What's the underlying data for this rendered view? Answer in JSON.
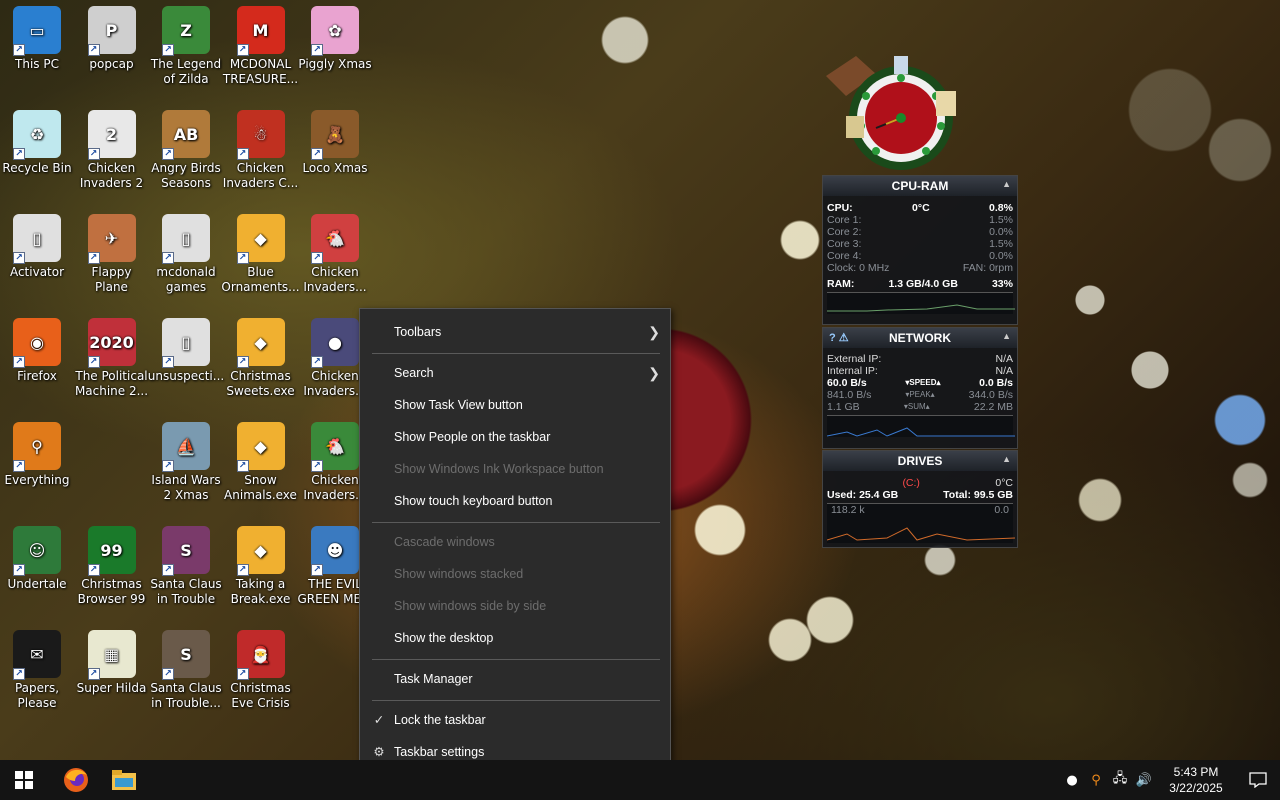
{
  "desktop": {
    "icons": [
      {
        "label": "This PC",
        "color": "#2a7fd0",
        "glyph": "▭"
      },
      {
        "label": "popcap",
        "color": "#cfcfcf",
        "glyph": "P"
      },
      {
        "label": "The Legend of Zilda",
        "color": "#3a8a3a",
        "glyph": "Z"
      },
      {
        "label": "MCDONAL TREASURE...",
        "color": "#d42a1c",
        "glyph": "M"
      },
      {
        "label": "Piggly Xmas",
        "color": "#e9a3d0",
        "glyph": "✿"
      },
      {
        "label": "Recycle Bin",
        "color": "#bfe8ee",
        "glyph": "♻"
      },
      {
        "label": "Chicken Invaders 2",
        "color": "#e8e8e8",
        "glyph": "2"
      },
      {
        "label": "Angry Birds Seasons",
        "color": "#b07a3a",
        "glyph": "AB"
      },
      {
        "label": "Chicken Invaders C...",
        "color": "#c03020",
        "glyph": "☃"
      },
      {
        "label": "Loco Xmas",
        "color": "#8a5a2a",
        "glyph": "🧸"
      },
      {
        "label": "Activator",
        "color": "#e0e0e0",
        "glyph": "▯"
      },
      {
        "label": "Flappy Plane",
        "color": "#c07040",
        "glyph": "✈"
      },
      {
        "label": "mcdonald games",
        "color": "#e0e0e0",
        "glyph": "▯"
      },
      {
        "label": "Blue Ornaments...",
        "color": "#f0b030",
        "glyph": "◆"
      },
      {
        "label": "Chicken Invaders...",
        "color": "#d04040",
        "glyph": "🐔"
      },
      {
        "label": "Firefox",
        "color": "#e8601a",
        "glyph": "◉"
      },
      {
        "label": "The Political Machine 2...",
        "color": "#c0303a",
        "glyph": "2020"
      },
      {
        "label": "unsuspecti...",
        "color": "#e0e0e0",
        "glyph": "▯"
      },
      {
        "label": "Christmas Sweets.exe",
        "color": "#f0b030",
        "glyph": "◆"
      },
      {
        "label": "Chicken Invaders...",
        "color": "#4a4a7a",
        "glyph": "●"
      },
      {
        "label": "Everything",
        "color": "#e07a1a",
        "glyph": "⚲"
      },
      {
        "label": "Island Wars 2 Xmas",
        "color": "#7a9ab0",
        "glyph": "⛵"
      },
      {
        "label": "Snow Animals.exe",
        "color": "#f0b030",
        "glyph": "◆"
      },
      {
        "label": "Chicken Invaders...",
        "color": "#3a8a3a",
        "glyph": "🐔"
      },
      {
        "label": "Undertale",
        "color": "#2e7a3a",
        "glyph": "☺"
      },
      {
        "label": "Christmas Browser 99",
        "color": "#1a7a2a",
        "glyph": "99"
      },
      {
        "label": "Santa Claus in Trouble",
        "color": "#7a3a6a",
        "glyph": "S"
      },
      {
        "label": "Taking a Break.exe",
        "color": "#f0b030",
        "glyph": "◆"
      },
      {
        "label": "THE EVIL GREEN ME...",
        "color": "#3a7ac0",
        "glyph": "☻"
      },
      {
        "label": "Papers, Please",
        "color": "#1a1a1a",
        "glyph": "✉"
      },
      {
        "label": "Super Hilda",
        "color": "#e8e8d0",
        "glyph": "▦"
      },
      {
        "label": "Santa Claus in Trouble...",
        "color": "#6a5a4a",
        "glyph": "S"
      },
      {
        "label": "Christmas Eve Crisis",
        "color": "#c02a2a",
        "glyph": "🎅"
      }
    ]
  },
  "widgets": {
    "cpu_ram": {
      "title": "CPU-RAM",
      "cpu_label": "CPU:",
      "cpu_temp": "0°C",
      "cpu_value": "0.8%",
      "cores": [
        {
          "label": "Core 1:",
          "value": "1.5%"
        },
        {
          "label": "Core 2:",
          "value": "0.0%"
        },
        {
          "label": "Core 3:",
          "value": "1.5%"
        },
        {
          "label": "Core 4:",
          "value": "0.0%"
        }
      ],
      "clock": "Clock: 0 MHz",
      "fan": "FAN: 0rpm",
      "ram_label": "RAM:",
      "ram_value": "1.3 GB/4.0 GB",
      "ram_pct": "33%"
    },
    "network": {
      "title": "NETWORK",
      "external_label": "External IP:",
      "external_value": "N/A",
      "internal_label": "Internal IP:",
      "internal_value": "N/A",
      "speed_down": "60.0 B/s",
      "speed_label": "▾SPEED▴",
      "speed_up": "0.0 B/s",
      "peak_down": "841.0 B/s",
      "peak_label": "▾PEAK▴",
      "peak_up": "344.0 B/s",
      "sum_down": "1.1 GB",
      "sum_label": "▾SUM▴",
      "sum_up": "22.2 MB"
    },
    "drives": {
      "title": "DRIVES",
      "drive_letter": "(C:)",
      "temp": "0°C",
      "used": "Used: 25.4 GB",
      "total": "Total: 99.5 GB",
      "read": "118.2 k",
      "write": "0.0"
    }
  },
  "context_menu": {
    "items": [
      {
        "label": "Toolbars",
        "submenu": true,
        "disabled": false
      },
      {
        "label": "Search",
        "submenu": true,
        "disabled": false
      },
      {
        "label": "Show Task View button",
        "disabled": false
      },
      {
        "label": "Show People on the taskbar",
        "disabled": false
      },
      {
        "label": "Show Windows Ink Workspace button",
        "disabled": true
      },
      {
        "label": "Show touch keyboard button",
        "disabled": false
      },
      {
        "label": "Cascade windows",
        "disabled": true
      },
      {
        "label": "Show windows stacked",
        "disabled": true
      },
      {
        "label": "Show windows side by side",
        "disabled": true
      },
      {
        "label": "Show the desktop",
        "disabled": false
      },
      {
        "label": "Task Manager",
        "disabled": false
      },
      {
        "label": "Lock the taskbar",
        "checked": true,
        "disabled": false
      },
      {
        "label": "Taskbar settings",
        "icon": "gear-icon",
        "disabled": false
      }
    ]
  },
  "taskbar": {
    "time": "5:43 PM",
    "date": "3/22/2025",
    "pinned": [
      "start-icon",
      "firefox-icon",
      "file-explorer-icon"
    ]
  },
  "colors": {
    "taskbar_bg": "#141414",
    "menu_bg": "#2b2b2b",
    "windows_blue": "#ffffff"
  }
}
